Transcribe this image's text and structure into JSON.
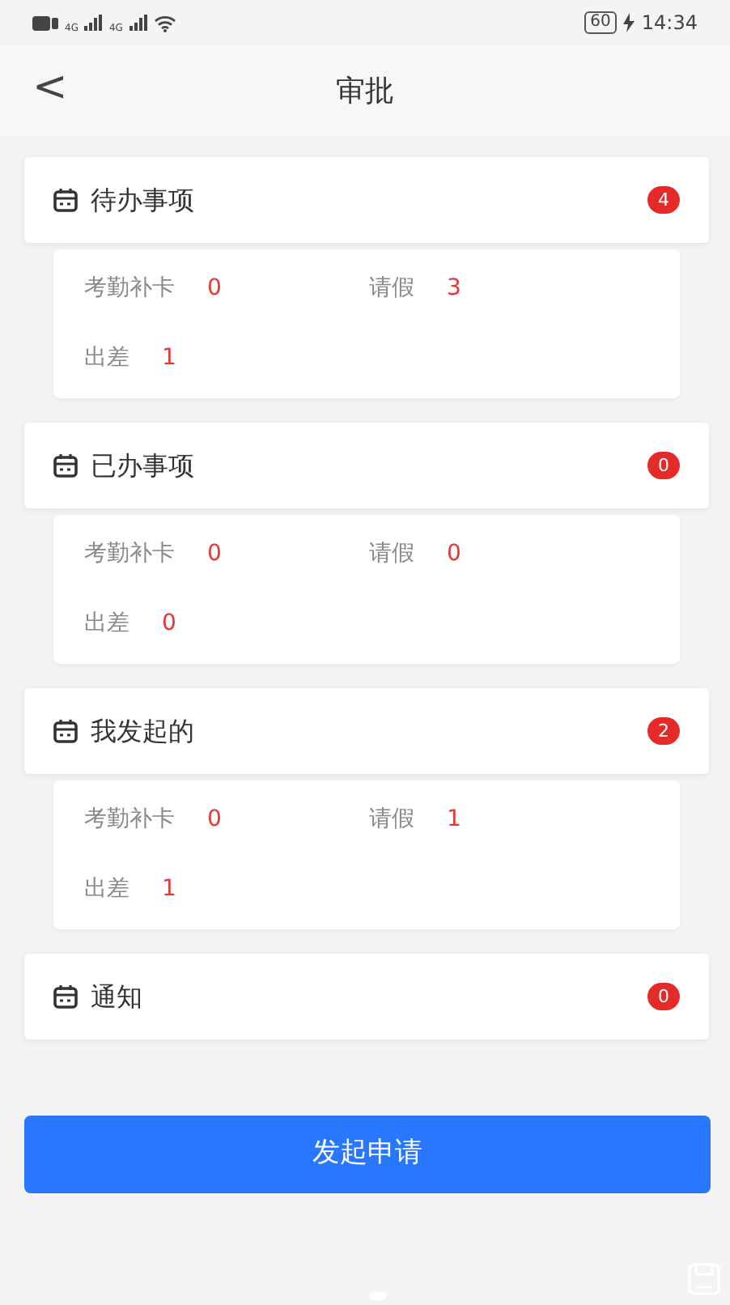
{
  "status_bar": {
    "network_labels": [
      "4G",
      "4G"
    ],
    "battery": "60",
    "time": "14:34"
  },
  "header": {
    "back": "<",
    "title": "审批"
  },
  "sections": [
    {
      "title": "待办事项",
      "count": "4",
      "items": [
        {
          "label": "考勤补卡",
          "value": "0"
        },
        {
          "label": "请假",
          "value": "3"
        },
        {
          "label": "出差",
          "value": "1"
        }
      ]
    },
    {
      "title": "已办事项",
      "count": "0",
      "items": [
        {
          "label": "考勤补卡",
          "value": "0"
        },
        {
          "label": "请假",
          "value": "0"
        },
        {
          "label": "出差",
          "value": "0"
        }
      ]
    },
    {
      "title": "我发起的",
      "count": "2",
      "items": [
        {
          "label": "考勤补卡",
          "value": "0"
        },
        {
          "label": "请假",
          "value": "1"
        },
        {
          "label": "出差",
          "value": "1"
        }
      ]
    },
    {
      "title": "通知",
      "count": "0"
    }
  ],
  "submit_button": "发起申请"
}
